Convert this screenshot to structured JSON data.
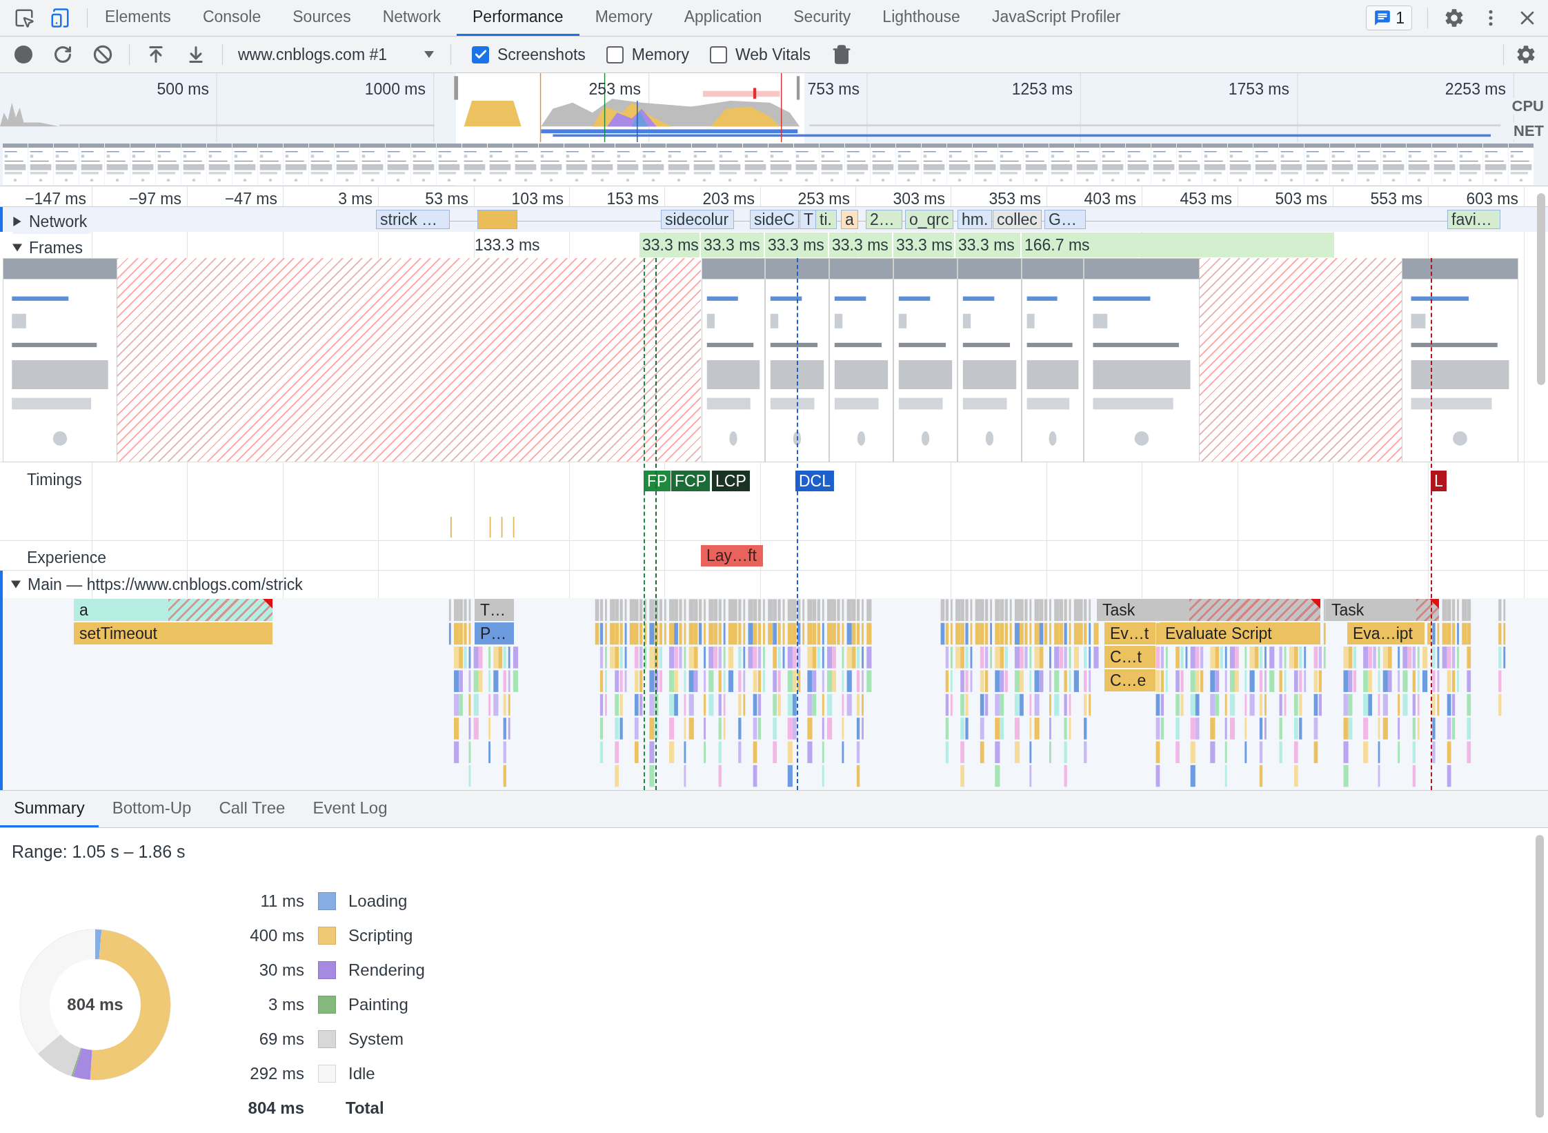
{
  "tabs": [
    {
      "label": "Elements",
      "selected": false
    },
    {
      "label": "Console",
      "selected": false
    },
    {
      "label": "Sources",
      "selected": false
    },
    {
      "label": "Network",
      "selected": false
    },
    {
      "label": "Performance",
      "selected": true
    },
    {
      "label": "Memory",
      "selected": false
    },
    {
      "label": "Application",
      "selected": false
    },
    {
      "label": "Security",
      "selected": false
    },
    {
      "label": "Lighthouse",
      "selected": false
    },
    {
      "label": "JavaScript Profiler",
      "selected": false
    }
  ],
  "issues_badge": {
    "count": "1"
  },
  "toolbar": {
    "recording": "www.cnblogs.com #1",
    "options": [
      {
        "label": "Screenshots",
        "checked": true
      },
      {
        "label": "Memory",
        "checked": false
      },
      {
        "label": "Web Vitals",
        "checked": false
      }
    ]
  },
  "overview": {
    "ticks": [
      "500 ms",
      "1000 ms",
      "253 ms",
      "753 ms",
      "1253 ms",
      "1753 ms",
      "2253 ms"
    ],
    "lanes": [
      "CPU",
      "NET"
    ]
  },
  "ruler": {
    "ticks": [
      "−147 ms",
      "−97 ms",
      "−47 ms",
      "3 ms",
      "53 ms",
      "103 ms",
      "153 ms",
      "203 ms",
      "253 ms",
      "303 ms",
      "353 ms",
      "403 ms",
      "453 ms",
      "503 ms",
      "553 ms",
      "603 ms"
    ]
  },
  "network": {
    "label": "Network",
    "expanded": false,
    "requests": [
      {
        "label": "strick …",
        "color": "#dbe6f8"
      },
      {
        "color": "#ebbd58"
      },
      {
        "label": "sidecolur",
        "color": "#dbe6f8"
      },
      {
        "label": "sideC",
        "color": "#dbe6f8"
      },
      {
        "label": "T",
        "color": "#dbe6f8"
      },
      {
        "label": "ti.",
        "color": "#d6ecd0"
      },
      {
        "label": "a",
        "color": "#fbe3c2"
      },
      {
        "label": "2…",
        "color": "#d6ecd0"
      },
      {
        "label": "o_qrc",
        "color": "#d6ecd0"
      },
      {
        "label": "hm.",
        "color": "#dbe6f8"
      },
      {
        "label": "collec",
        "color": "#e6e6e6"
      },
      {
        "label": "G…",
        "color": "#dbe6f8"
      },
      {
        "label": "favi…",
        "color": "#d6ecd0"
      }
    ]
  },
  "frames": {
    "label": "Frames",
    "expanded": true,
    "frames": [
      {
        "duration": "133.3 ms",
        "kind": "idle"
      },
      {
        "duration": "33.3 ms",
        "kind": "drawn"
      },
      {
        "duration": "33.3 ms",
        "kind": "drawn"
      },
      {
        "duration": "33.3 ms",
        "kind": "drawn"
      },
      {
        "duration": "33.3 ms",
        "kind": "drawn"
      },
      {
        "duration": "33.3 ms",
        "kind": "drawn"
      },
      {
        "duration": "33.3 ms",
        "kind": "drawn"
      },
      {
        "duration": "166.7 ms",
        "kind": "drawn"
      }
    ]
  },
  "timings": {
    "label": "Timings",
    "markers": [
      {
        "label": "FP",
        "color": "#1e8a3e"
      },
      {
        "label": "FCP",
        "color": "#1d6b37"
      },
      {
        "label": "LCP",
        "color": "#1b3325"
      },
      {
        "label": "DCL",
        "color": "#1d60cc"
      },
      {
        "label": "L",
        "color": "#b3141c"
      }
    ]
  },
  "experience": {
    "label": "Experience",
    "events": [
      {
        "label": "Lay…ft",
        "color": "#e9625c"
      }
    ]
  },
  "main": {
    "label": "Main — https://www.cnblogs.com/strick",
    "expanded": true,
    "events": [
      {
        "label": "a",
        "color": "#b6ede2",
        "long": true
      },
      {
        "label": "T…",
        "color": "#c4c4c4",
        "long": false
      },
      {
        "label": "Task",
        "color": "#c4c4c4",
        "long": true
      },
      {
        "label": "Task",
        "color": "#c4c4c4",
        "long": true
      },
      {
        "label": "setTimeout",
        "color": "#ecc160",
        "long": false
      },
      {
        "label": "P…",
        "color": "#6c9be0",
        "long": false
      },
      {
        "label": "Ev…t",
        "color": "#ecc160",
        "long": false
      },
      {
        "label": "Evaluate Script",
        "color": "#ecc160",
        "long": false
      },
      {
        "label": "Eva…ipt",
        "color": "#ecc160",
        "long": false
      },
      {
        "label": "C…t",
        "color": "#ecc160",
        "long": false
      },
      {
        "label": "C…e",
        "color": "#ecc160",
        "long": false
      }
    ]
  },
  "bottom_tabs": [
    {
      "label": "Summary",
      "selected": true
    },
    {
      "label": "Bottom-Up",
      "selected": false
    },
    {
      "label": "Call Tree",
      "selected": false
    },
    {
      "label": "Event Log",
      "selected": false
    }
  ],
  "summary": {
    "range": "Range: 1.05 s – 1.86 s",
    "center_label": "804 ms",
    "categories": [
      {
        "value": "11 ms",
        "color": "#86aee5"
      },
      {
        "value": "400 ms",
        "color": "#f0c976"
      },
      {
        "value": "30 ms",
        "color": "#a68ae2"
      },
      {
        "value": "3 ms",
        "color": "#85b87c"
      },
      {
        "value": "69 ms",
        "color": "#d8d8d8"
      },
      {
        "value": "292 ms",
        "color": "#f6f6f6"
      }
    ],
    "total": {
      "value": "804 ms",
      "label": "Total"
    },
    "chart_data": {
      "type": "donut",
      "categories": [
        "Loading",
        "Scripting",
        "Rendering",
        "Painting",
        "System",
        "Idle"
      ],
      "values": [
        1.37,
        49.69,
        3.73,
        0.37,
        8.57,
        36.27
      ]
    }
  }
}
